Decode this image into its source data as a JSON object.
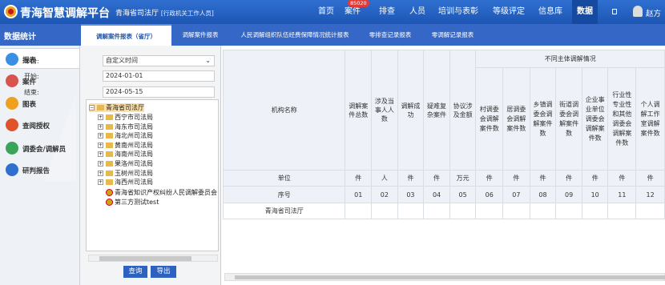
{
  "app": {
    "title": "青海智慧调解平台",
    "org": "青海省司法厅",
    "role": "[行政机关工作人员]",
    "user": "赵方"
  },
  "nav": [
    {
      "label": "首页",
      "active": false
    },
    {
      "label": "案件",
      "active": false,
      "badge": "85020"
    },
    {
      "label": "排查",
      "active": false
    },
    {
      "label": "人员",
      "active": false
    },
    {
      "label": "培训与表彰",
      "active": false
    },
    {
      "label": "等级评定",
      "active": false
    },
    {
      "label": "信息库",
      "active": false
    },
    {
      "label": "数据",
      "active": true
    }
  ],
  "section": "数据统计",
  "tabs": [
    {
      "label": "调解案件报表（省厅）",
      "active": true
    },
    {
      "label": "调解案件报表",
      "active": false
    },
    {
      "label": "人民调解组织队伍经费保障情况统计报表",
      "active": false
    },
    {
      "label": "零排查记录报表",
      "active": false
    },
    {
      "label": "零调解记录报表",
      "active": false
    }
  ],
  "sidebar": [
    {
      "label": "报表",
      "icon": "report-icon",
      "color": "#3a8ee6",
      "active": true
    },
    {
      "label": "案件",
      "icon": "case-icon",
      "color": "#d9534f",
      "active": false
    },
    {
      "label": "图表",
      "icon": "chart-icon",
      "color": "#f0a020",
      "active": false
    },
    {
      "label": "查阅授权",
      "icon": "auth-icon",
      "color": "#e0522a",
      "active": false
    },
    {
      "label": "调委会/调解员",
      "icon": "committee-icon",
      "color": "#3aa55a",
      "active": false
    },
    {
      "label": "研判报告",
      "icon": "analysis-icon",
      "color": "#2f6fd0",
      "active": false
    }
  ],
  "filter": {
    "year_label": "年份:",
    "year_value": "自定义时间",
    "start_label": "开始:",
    "start_value": "2024-01-01",
    "end_label": "结束:",
    "end_value": "2024-05-15"
  },
  "tree": {
    "root": "青海省司法厅",
    "children": [
      "西宁市司法局",
      "海东市司法局",
      "海北州司法局",
      "黄南州司法局",
      "海南州司法局",
      "果洛州司法局",
      "玉树州司法局",
      "海西州司法局"
    ],
    "leaves": [
      "青海省知识产权纠纷人民调解委员会",
      "第三方测试test"
    ]
  },
  "buttons": {
    "query": "查询",
    "export": "导出"
  },
  "table": {
    "name_header": "机构名称",
    "group_header": "不同主体调解情况",
    "columns": [
      {
        "header": "调解案件总数",
        "unit": "件",
        "seq": "01"
      },
      {
        "header": "涉及当事人人数",
        "unit": "人",
        "seq": "02"
      },
      {
        "header": "调解成功",
        "unit": "件",
        "seq": "03"
      },
      {
        "header": "疑难复杂案件",
        "unit": "件",
        "seq": "04"
      },
      {
        "header": "协议涉及金额",
        "unit": "万元",
        "seq": "05"
      },
      {
        "header": "村调委会调解案件数",
        "unit": "件",
        "seq": "06"
      },
      {
        "header": "居调委会调解案件数",
        "unit": "件",
        "seq": "07"
      },
      {
        "header": "乡镇调委会调解案件数",
        "unit": "件",
        "seq": "08"
      },
      {
        "header": "街道调委会调解案件数",
        "unit": "件",
        "seq": "09"
      },
      {
        "header": "企业事业单位调委会调解案件数",
        "unit": "件",
        "seq": "10"
      },
      {
        "header": "行业性专业性和其他调委会调解案件数",
        "unit": "件",
        "seq": "11"
      },
      {
        "header": "个人调解工作室调解案件数",
        "unit": "件",
        "seq": "12"
      }
    ],
    "unit_label": "单位",
    "seq_label": "序号",
    "rows": [
      "青海省司法厅"
    ]
  }
}
